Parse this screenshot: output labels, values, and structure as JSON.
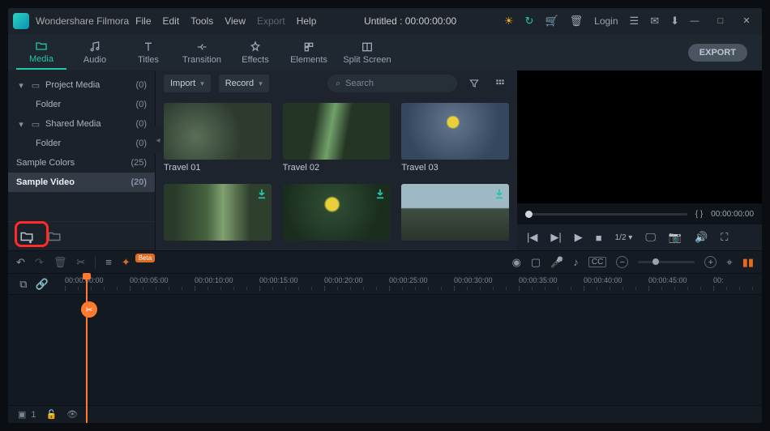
{
  "app": {
    "name": "Wondershare Filmora",
    "document": "Untitled : 00:00:00:00"
  },
  "menu": {
    "file": "File",
    "edit": "Edit",
    "tools": "Tools",
    "view": "View",
    "export": "Export",
    "help": "Help"
  },
  "titlebar": {
    "login": "Login"
  },
  "tabs": {
    "media": "Media",
    "audio": "Audio",
    "titles": "Titles",
    "transition": "Transition",
    "effects": "Effects",
    "elements": "Elements",
    "split": "Split Screen",
    "export": "EXPORT"
  },
  "sidebar": {
    "items": [
      {
        "label": "Project Media",
        "count": "(0)",
        "collapsible": true
      },
      {
        "label": "Folder",
        "count": "(0)",
        "indent": true
      },
      {
        "label": "Shared Media",
        "count": "(0)",
        "collapsible": true
      },
      {
        "label": "Folder",
        "count": "(0)",
        "indent": true
      },
      {
        "label": "Sample Colors",
        "count": "(25)"
      },
      {
        "label": "Sample Video",
        "count": "(20)",
        "active": true
      }
    ]
  },
  "toolbar": {
    "import": "Import",
    "record": "Record",
    "search_placeholder": "Search"
  },
  "clips": [
    {
      "label": "Travel 01",
      "art": "th1"
    },
    {
      "label": "Travel 02",
      "art": "th2"
    },
    {
      "label": "Travel 03",
      "art": "th3"
    },
    {
      "label": "",
      "art": "th4",
      "dl": true
    },
    {
      "label": "",
      "art": "th5",
      "dl": true
    },
    {
      "label": "",
      "art": "th6",
      "dl": true
    }
  ],
  "preview": {
    "markers": "{       }",
    "time": "00:00:00:00",
    "ratio": "1/2"
  },
  "timeline": {
    "badge": "Beta",
    "ticks": [
      "00:00:00:00",
      "00:00:05:00",
      "00:00:10:00",
      "00:00:15:00",
      "00:00:20:00",
      "00:00:25:00",
      "00:00:30:00",
      "00:00:35:00",
      "00:00:40:00",
      "00:00:45:00",
      "00:"
    ],
    "foot_track": "1"
  },
  "icons": {
    "sun": "☀",
    "refresh": "↻",
    "cart": "🛒",
    "trash": "🗑",
    "menu": "☰",
    "mail": "✉",
    "download": "⬇",
    "min": "—",
    "max": "□",
    "close": "✕",
    "chev": "▾",
    "caret": "◂",
    "filter": "⛉",
    "grid": "▦",
    "undo": "↶",
    "redo": "↷",
    "scissors": "✂",
    "markers": "≡",
    "magic": "✦",
    "rec": "◉",
    "shield": "▢",
    "mic": "🎤",
    "music": "♪",
    "cc": "CC",
    "zoom_out": "−",
    "zoom_in": "+",
    "fit": "⌖",
    "prev": "|◀",
    "step": "▶|",
    "play": "▶",
    "stop": "■",
    "display": "🖵",
    "camera": "📷",
    "volume": "🔊",
    "full": "⛶",
    "link": "🔗",
    "stack": "⧉",
    "lock": "🔓",
    "eye": "👁",
    "add_folder": "⊕",
    "new_folder": "▭"
  }
}
